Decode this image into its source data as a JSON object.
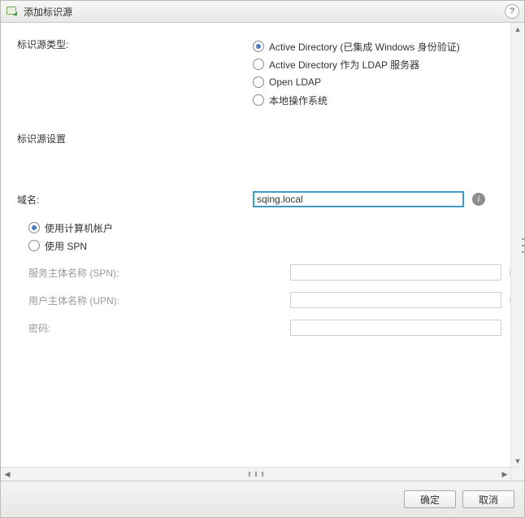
{
  "window": {
    "title": "添加标识源"
  },
  "sections": {
    "type_label": "标识源类型:",
    "settings_label": "标识源设置"
  },
  "type_options": {
    "ad_integrated": "Active Directory (已集成 Windows 身份验证)",
    "ad_ldap": "Active Directory 作为 LDAP 服务器",
    "open_ldap": "Open LDAP",
    "local_os": "本地操作系统"
  },
  "fields": {
    "domain_label": "域名:",
    "domain_value": "sqing.local",
    "use_machine_account": "使用计算机帐户",
    "use_spn": "使用 SPN",
    "spn_label": "服务主体名称 (SPN):",
    "upn_label": "用户主体名称 (UPN):",
    "password_label": "密码:"
  },
  "buttons": {
    "ok": "确定",
    "cancel": "取消"
  }
}
